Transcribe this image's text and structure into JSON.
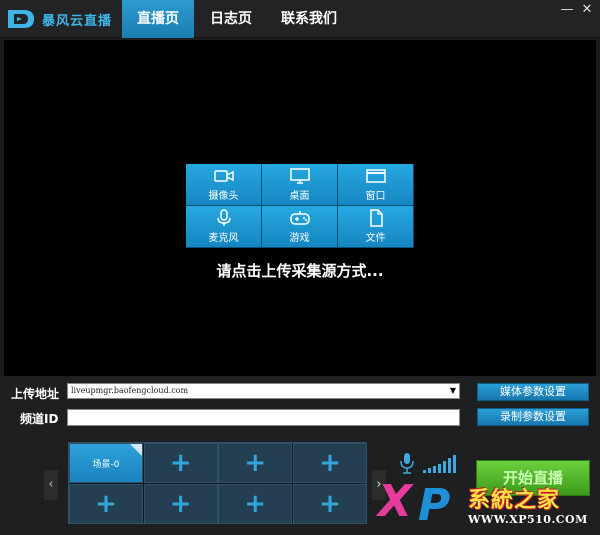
{
  "app": {
    "title": "暴风云直播",
    "brand_color": "#3fb4e6"
  },
  "tabs": [
    {
      "label": "直播页",
      "active": true
    },
    {
      "label": "日志页",
      "active": false
    },
    {
      "label": "联系我们",
      "active": false
    }
  ],
  "window": {
    "minimize_glyph": "—",
    "close_glyph": "✕"
  },
  "sources": [
    {
      "label": "摄像头",
      "icon": "camera-icon"
    },
    {
      "label": "桌面",
      "icon": "monitor-icon"
    },
    {
      "label": "窗口",
      "icon": "window-icon"
    },
    {
      "label": "麦克风",
      "icon": "microphone-icon"
    },
    {
      "label": "游戏",
      "icon": "gamepad-icon"
    },
    {
      "label": "文件",
      "icon": "file-icon"
    }
  ],
  "preview": {
    "hint": "请点击上传采集源方式..."
  },
  "upload": {
    "label": "上传地址",
    "value": "liveupmgr.baofengcloud.com"
  },
  "channel": {
    "label": "频道ID",
    "value": ""
  },
  "buttons": {
    "media_settings": "媒体参数设置",
    "record_settings": "录制参数设置",
    "start_live": "开始直播"
  },
  "scenes": {
    "active_label": "场景-0",
    "slots": 8,
    "prev_glyph": "‹",
    "next_glyph": "›",
    "add_glyph": "+"
  },
  "audio": {
    "signal_bars": 7
  },
  "watermark": {
    "x": "X",
    "p": "P",
    "cn": "系統之家",
    "url": "WWW.XP510.COM"
  }
}
